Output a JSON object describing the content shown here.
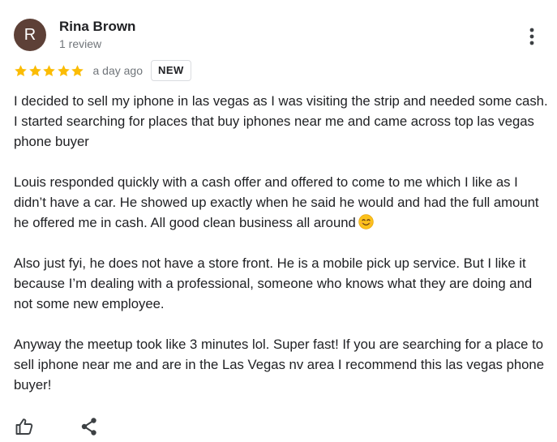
{
  "reviewer": {
    "avatar_initial": "R",
    "avatar_color": "#5d4037",
    "name": "Rina Brown",
    "review_count": "1 review"
  },
  "rating": {
    "stars": 5,
    "max_stars": 5,
    "star_color": "#fbbc04",
    "date": "a day ago",
    "badge": "NEW"
  },
  "review": {
    "paragraphs": [
      "I decided to sell my iphone in las vegas as I was visiting the strip and needed some cash. I started searching for places that buy iphones near me and came across top las vegas phone buyer",
      "Louis responded quickly with a cash offer and offered to come to me which I like as I didn’t have a car. He showed up exactly when he said he would and had the full amount he offered me in cash. All good clean business all around",
      "Also just fyi, he does not have a store front. He is a mobile pick up service. But I like it because I’m dealing with a professional, someone who knows what they are doing and not some new employee.",
      "Anyway the meetup took like 3 minutes lol. Super fast! If you are searching for a place to sell iphone near me and are in the Las Vegas nv area I recommend this las vegas phone buyer!"
    ],
    "emoji": "smiling-face-emoji"
  },
  "actions": {
    "more_icon": "more-vert-icon",
    "like_icon": "thumb-up-icon",
    "share_icon": "share-icon"
  }
}
